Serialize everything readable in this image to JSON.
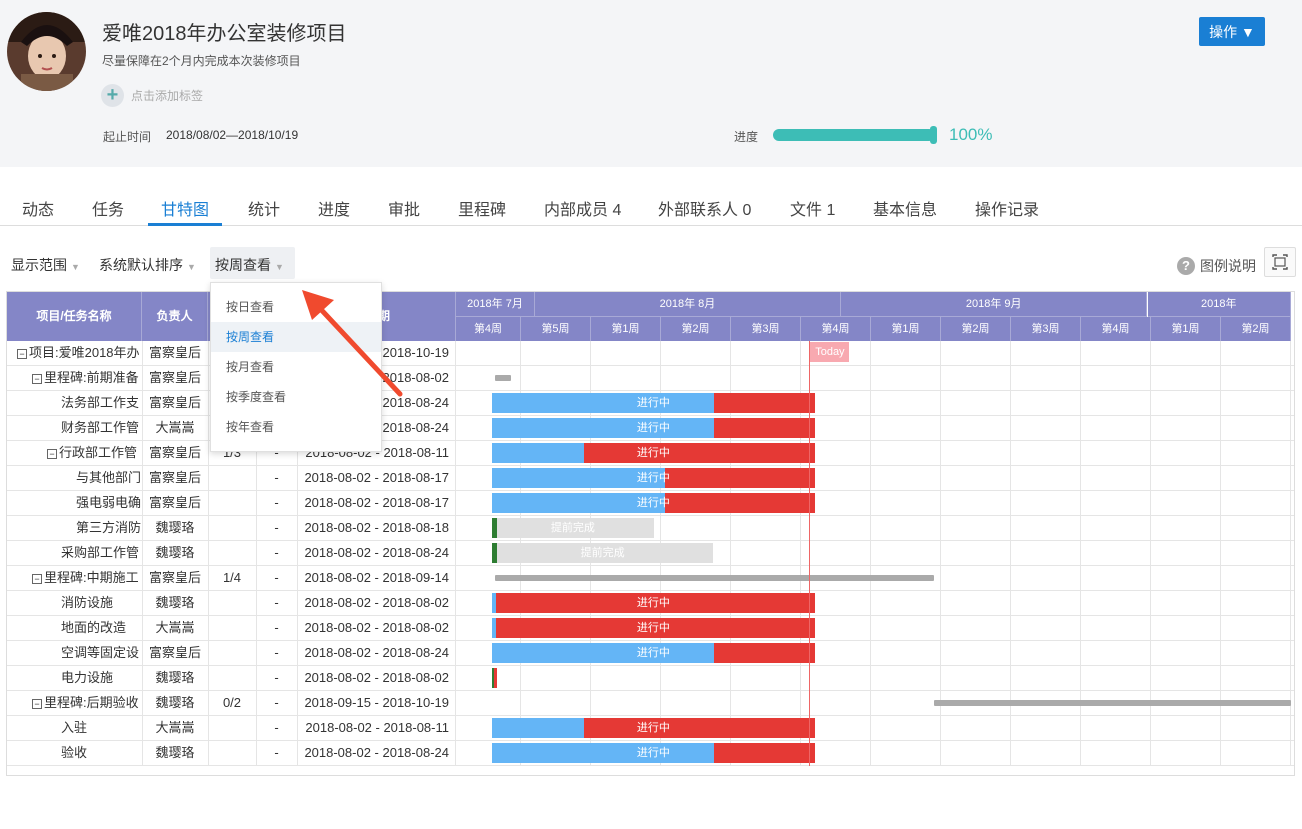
{
  "project": {
    "title": "爱唯2018年办公室装修项目",
    "subtitle": "尽量保障在2个月内完成本次装修项目",
    "add_tag": "点击添加标签",
    "date_label": "起止时间",
    "date_range": "2018/08/02—2018/10/19",
    "progress_label": "进度",
    "progress_percent": "100%",
    "progress_value": 1.0,
    "action_button": "操作 ▼"
  },
  "tabs": [
    "动态",
    "任务",
    "甘特图",
    "统计",
    "进度",
    "审批",
    "里程碑",
    "内部成员 4",
    "外部联系人 0",
    "文件 1",
    "基本信息",
    "操作记录"
  ],
  "active_tab": "甘特图",
  "toolbar": {
    "range": "显示范围",
    "sort": "系统默认排序",
    "view": "按周查看",
    "legend": "图例说明"
  },
  "view_dropdown": {
    "options": [
      "按日查看",
      "按周查看",
      "按月查看",
      "按季度查看",
      "按年查看"
    ],
    "selected": "按周查看"
  },
  "table": {
    "headers": [
      "项目/任务名称",
      "负责人",
      "",
      "",
      "期"
    ],
    "rows": [
      {
        "name": "项目:爱唯2018年办",
        "owner": "富察皇后",
        "count": "",
        "dash": "",
        "dates": "2018-10-19",
        "level": 0,
        "toggle": true
      },
      {
        "name": "里程碑:前期准备",
        "owner": "富察皇后",
        "count": "",
        "dash": "",
        "dates": "2018-08-02",
        "level": 1,
        "toggle": true
      },
      {
        "name": "法务部工作支",
        "owner": "富察皇后",
        "count": "",
        "dash": "",
        "dates": "2018-08-24",
        "level": 2,
        "toggle": false
      },
      {
        "name": "财务部工作管",
        "owner": "大嵩嵩",
        "count": "",
        "dash": "",
        "dates": "2018-08-24",
        "level": 2,
        "toggle": false
      },
      {
        "name": "行政部工作管",
        "owner": "富察皇后",
        "count": "1/3",
        "dash": "-",
        "dates": "2018-08-02 - 2018-08-11",
        "level": 2,
        "toggle": true
      },
      {
        "name": "与其他部门",
        "owner": "富察皇后",
        "count": "",
        "dash": "-",
        "dates": "2018-08-02 - 2018-08-17",
        "level": 3,
        "toggle": false
      },
      {
        "name": "强电弱电确",
        "owner": "富察皇后",
        "count": "",
        "dash": "-",
        "dates": "2018-08-02 - 2018-08-17",
        "level": 3,
        "toggle": false
      },
      {
        "name": "第三方消防",
        "owner": "魏璎珞",
        "count": "",
        "dash": "-",
        "dates": "2018-08-02 - 2018-08-18",
        "level": 3,
        "toggle": false
      },
      {
        "name": "采购部工作管",
        "owner": "魏璎珞",
        "count": "",
        "dash": "-",
        "dates": "2018-08-02 - 2018-08-24",
        "level": 2,
        "toggle": false
      },
      {
        "name": "里程碑:中期施工",
        "owner": "富察皇后",
        "count": "1/4",
        "dash": "-",
        "dates": "2018-08-02 - 2018-09-14",
        "level": 1,
        "toggle": true
      },
      {
        "name": "消防设施",
        "owner": "魏璎珞",
        "count": "",
        "dash": "-",
        "dates": "2018-08-02 - 2018-08-02",
        "level": 2,
        "toggle": false
      },
      {
        "name": "地面的改造",
        "owner": "大嵩嵩",
        "count": "",
        "dash": "-",
        "dates": "2018-08-02 - 2018-08-02",
        "level": 2,
        "toggle": false
      },
      {
        "name": "空调等固定设",
        "owner": "富察皇后",
        "count": "",
        "dash": "-",
        "dates": "2018-08-02 - 2018-08-24",
        "level": 2,
        "toggle": false
      },
      {
        "name": "电力设施",
        "owner": "魏璎珞",
        "count": "",
        "dash": "-",
        "dates": "2018-08-02 - 2018-08-02",
        "level": 2,
        "toggle": false
      },
      {
        "name": "里程碑:后期验收",
        "owner": "魏璎珞",
        "count": "0/2",
        "dash": "-",
        "dates": "2018-09-15 - 2018-10-19",
        "level": 1,
        "toggle": true
      },
      {
        "name": "入驻",
        "owner": "大嵩嵩",
        "count": "",
        "dash": "-",
        "dates": "2018-08-02 - 2018-08-11",
        "level": 2,
        "toggle": false
      },
      {
        "name": "验收",
        "owner": "魏璎珞",
        "count": "",
        "dash": "-",
        "dates": "2018-08-02 - 2018-08-24",
        "level": 2,
        "toggle": false
      }
    ]
  },
  "gantt": {
    "months": [
      "2018年 7月",
      "2018年 8月",
      "2018年 9月",
      "2018年"
    ],
    "weeks": [
      "第4周",
      "第5周",
      "第1周",
      "第2周",
      "第3周",
      "第4周",
      "第1周",
      "第2周",
      "第3周",
      "第4周",
      "第1周",
      "第2周"
    ],
    "today_label": "Today",
    "status_in_progress": "进行中",
    "status_early": "提前完成",
    "colors": {
      "blue": "#64b5f6",
      "red": "#e53935",
      "gray": "#e0e0e0",
      "green": "#2e7d32",
      "milestone": "#aaa",
      "header": "#8486c7",
      "accent": "#1a7fd4",
      "teal": "#3dbdb6"
    },
    "bars": [
      {
        "row": 1,
        "type": "milestone",
        "start": 0.6,
        "end": 0.85
      },
      {
        "row": 2,
        "type": "progress",
        "start": 0.55,
        "split": 3.75,
        "end": 5.2,
        "label": "进行中"
      },
      {
        "row": 3,
        "type": "progress",
        "start": 0.55,
        "split": 3.75,
        "end": 5.2,
        "label": "进行中"
      },
      {
        "row": 4,
        "type": "progress",
        "start": 0.55,
        "split": 1.9,
        "end": 5.2,
        "label": "进行中"
      },
      {
        "row": 5,
        "type": "progress",
        "start": 0.55,
        "split": 3.05,
        "end": 5.2,
        "label": "进行中"
      },
      {
        "row": 6,
        "type": "progress",
        "start": 0.55,
        "split": 3.05,
        "end": 5.2,
        "label": "进行中"
      },
      {
        "row": 7,
        "type": "early",
        "start": 0.55,
        "split": 0.63,
        "end": 2.9,
        "label": "提前完成"
      },
      {
        "row": 8,
        "type": "early",
        "start": 0.55,
        "split": 0.63,
        "end": 3.75,
        "label": "提前完成"
      },
      {
        "row": 9,
        "type": "milestone",
        "start": 0.6,
        "end": 6.9
      },
      {
        "row": 10,
        "type": "progress",
        "start": 0.55,
        "split": 0.61,
        "end": 5.2,
        "label": "进行中"
      },
      {
        "row": 11,
        "type": "progress",
        "start": 0.55,
        "split": 0.61,
        "end": 5.2,
        "label": "进行中"
      },
      {
        "row": 12,
        "type": "progress",
        "start": 0.55,
        "split": 3.75,
        "end": 5.2,
        "label": "进行中"
      },
      {
        "row": 13,
        "type": "tiny",
        "start": 0.55,
        "end": 0.63
      },
      {
        "row": 14,
        "type": "milestone",
        "start": 6.9,
        "end": 12.0
      },
      {
        "row": 15,
        "type": "progress",
        "start": 0.55,
        "split": 1.9,
        "end": 5.2,
        "label": "进行中"
      },
      {
        "row": 16,
        "type": "progress",
        "start": 0.55,
        "split": 3.75,
        "end": 5.2,
        "label": "进行中"
      }
    ],
    "today_week": 5.12
  }
}
